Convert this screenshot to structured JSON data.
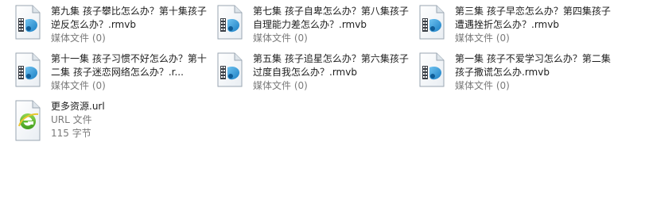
{
  "files": [
    {
      "name": "第九集 孩子攀比怎么办？第十集孩子逆反怎么办？.rmvb",
      "type": "媒体文件",
      "size": "(0)",
      "icon": "media-file-icon"
    },
    {
      "name": "第七集 孩子自卑怎么办？第八集孩子自理能力差怎么办？.rmvb",
      "type": "媒体文件",
      "size": "(0)",
      "icon": "media-file-icon"
    },
    {
      "name": "第三集 孩子早恋怎么办？第四集孩子遭遇挫折怎么办？.rmvb",
      "type": "媒体文件",
      "size": "(0)",
      "icon": "media-file-icon"
    },
    {
      "name": "第十一集 孩子习惯不好怎么办？第十二集 孩子迷恋网络怎么办？.r...",
      "type": "媒体文件",
      "size": "(0)",
      "icon": "media-file-icon"
    },
    {
      "name": "第五集 孩子追星怎么办？第六集孩子过度自我怎么办？.rmvb",
      "type": "媒体文件",
      "size": "(0)",
      "icon": "media-file-icon"
    },
    {
      "name": "第一集 孩子不爱学习怎么办？第二集孩子撒谎怎么办.rmvb",
      "type": "媒体文件",
      "size": "(0)",
      "icon": "media-file-icon"
    },
    {
      "name": "更多资源.url",
      "type": "URL 文件",
      "size": "115 字节",
      "icon": "url-file-icon"
    }
  ]
}
